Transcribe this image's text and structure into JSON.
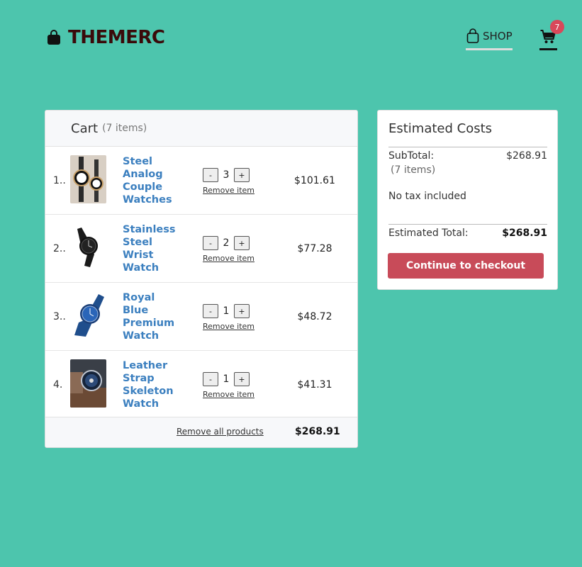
{
  "header": {
    "brand": "THEMERC",
    "nav_shop": "SHOP",
    "cart_badge": "7"
  },
  "cart": {
    "title": "Cart",
    "count_label": "(7 items)",
    "items": [
      {
        "index": "1..",
        "name": "Steel Analog Couple Watches",
        "qty": "3",
        "price": "$101.61",
        "remove": "Remove item",
        "minus": "-",
        "plus": "+"
      },
      {
        "index": "2..",
        "name": "Stainless Steel Wrist Watch",
        "qty": "2",
        "price": "$77.28",
        "remove": "Remove item",
        "minus": "-",
        "plus": "+"
      },
      {
        "index": "3..",
        "name": "Royal Blue Premium Watch",
        "qty": "1",
        "price": "$48.72",
        "remove": "Remove item",
        "minus": "-",
        "plus": "+"
      },
      {
        "index": "4.",
        "name": "Leather Strap Skeleton Watch",
        "qty": "1",
        "price": "$41.31",
        "remove": "Remove item",
        "minus": "-",
        "plus": "+"
      }
    ],
    "remove_all": "Remove all products",
    "total": "$268.91"
  },
  "estimate": {
    "title": "Estimated Costs",
    "subtotal_label": "SubTotal:",
    "subtotal_items": "(7 items)",
    "subtotal_value": "$268.91",
    "tax_note": "No tax included",
    "total_label": "Estimated Total:",
    "total_value": "$268.91",
    "checkout_label": "Continue to checkout"
  },
  "colors": {
    "background": "#4dc5ad",
    "brand": "#3a0a0a",
    "link": "#3b7fbf",
    "checkout": "#c84b59",
    "badge": "#d9485a"
  }
}
